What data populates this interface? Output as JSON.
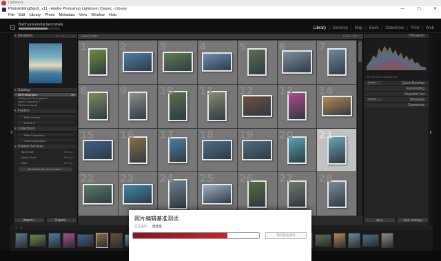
{
  "os_bar": {
    "title": "Lightroom"
  },
  "window": {
    "title": "PhotoEditingBatch_v11 - Adobe Photoshop Lightroom Classic - Library",
    "minimize": "—",
    "maximize": "▢",
    "close": "✕"
  },
  "menu": [
    "File",
    "Edit",
    "Library",
    "Photo",
    "Metadata",
    "View",
    "Window",
    "Help"
  ],
  "identity_plate": {
    "badge": "Lr",
    "task_label": "Batch processing benchmark",
    "task_progress": 0.7,
    "modules": [
      "Library",
      "Develop",
      "Map",
      "Book",
      "Slideshow",
      "Print",
      "Web"
    ],
    "active_module": "Library"
  },
  "left_panel": {
    "navigator": {
      "title": "Navigator",
      "options": "FIT  FILL  1:1  3:1"
    },
    "catalog": {
      "title": "Catalog",
      "items": [
        {
          "label": "All Photographs",
          "count": "44"
        },
        {
          "label": "All Synced Photographs",
          "count": ""
        },
        {
          "label": "Quick Collection +",
          "count": ""
        },
        {
          "label": "Previous Import",
          "count": ""
        }
      ]
    },
    "folders": {
      "title": "Folders",
      "rows": [
        "Filter Folders",
        "DRIVE C"
      ]
    },
    "collections": {
      "title": "Collections",
      "rows": [
        "Filter Collections",
        "Smart Collections"
      ]
    },
    "publish": {
      "title": "Publish Services",
      "services": [
        {
          "label": "Hard Drive",
          "setup": "Set Up..."
        },
        {
          "label": "Adobe Stock",
          "setup": "Set Up..."
        },
        {
          "label": "Flickr",
          "setup": "Set Up..."
        }
      ],
      "find_more": "Find More Services Online..."
    },
    "import_label": "Import...",
    "export_label": "Export..."
  },
  "library_filter": {
    "title": "Library Filter :",
    "options": [
      "Text",
      "Attribute",
      "Metadata",
      "None"
    ],
    "selected": "None",
    "presets": "Filters Off ▾"
  },
  "grid": {
    "selected_index": 21,
    "cells": [
      {
        "n": "1",
        "w": 28,
        "h": 40,
        "c": "#6f8a3e"
      },
      {
        "n": "2",
        "w": 44,
        "h": 30,
        "c": "#4f7ea1"
      },
      {
        "n": "3",
        "w": 44,
        "h": 30,
        "c": "#5d7f52"
      },
      {
        "n": "4",
        "w": 44,
        "h": 28,
        "c": "#6a8fb0"
      },
      {
        "n": "5",
        "w": 28,
        "h": 40,
        "c": "#5d6e54"
      },
      {
        "n": "6",
        "w": 44,
        "h": 34,
        "c": "#7f8fa0"
      },
      {
        "n": "7",
        "w": 28,
        "h": 40,
        "c": "#6d8a9e"
      },
      {
        "n": "8",
        "w": 30,
        "h": 42,
        "c": "#7d8b5e"
      },
      {
        "n": "9",
        "w": 28,
        "h": 42,
        "c": "#8a8f8b"
      },
      {
        "n": "10",
        "w": 28,
        "h": 44,
        "c": "#5a6f4e"
      },
      {
        "n": "11",
        "w": 28,
        "h": 44,
        "c": "#8c8b70"
      },
      {
        "n": "12",
        "w": 44,
        "h": 32,
        "c": "#6b4f3a"
      },
      {
        "n": "13",
        "w": 28,
        "h": 42,
        "c": "#b04a8e"
      },
      {
        "n": "14",
        "w": 44,
        "h": 30,
        "c": "#b78a4f"
      },
      {
        "n": "15",
        "w": 44,
        "h": 30,
        "c": "#3f5f85"
      },
      {
        "n": "16",
        "w": 28,
        "h": 40,
        "c": "#8a6d3f"
      },
      {
        "n": "17",
        "w": 28,
        "h": 38,
        "c": "#4d7fa0"
      },
      {
        "n": "18",
        "w": 44,
        "h": 30,
        "c": "#4d6e86"
      },
      {
        "n": "19",
        "w": 44,
        "h": 30,
        "c": "#4e6f7d"
      },
      {
        "n": "20",
        "w": 28,
        "h": 40,
        "c": "#56a3b0"
      },
      {
        "n": "21",
        "w": 28,
        "h": 42,
        "c": "#6ba3b8"
      },
      {
        "n": "22",
        "w": 44,
        "h": 30,
        "c": "#5b7a64"
      },
      {
        "n": "23",
        "w": 44,
        "h": 30,
        "c": "#3f85a8"
      },
      {
        "n": "24",
        "w": 28,
        "h": 44,
        "c": "#6e7e8c"
      },
      {
        "n": "25",
        "w": 44,
        "h": 30,
        "c": "#9bb0be"
      },
      {
        "n": "26",
        "w": 28,
        "h": 40,
        "c": "#596a3f"
      },
      {
        "n": "27",
        "w": 28,
        "h": 40,
        "c": "#6d7c6a"
      },
      {
        "n": "28",
        "w": 28,
        "h": 40,
        "c": "#7a8c9a"
      }
    ]
  },
  "right_panel": {
    "histogram": {
      "title": "Histogram",
      "info": "ISO 100   24mm   f/8   1/250 sec"
    },
    "quick_develop": {
      "title": "Quick Develop",
      "preset": "Saved Preset"
    },
    "keywording": "Keywording",
    "keyword_list": "Keyword List",
    "metadata": {
      "title": "Metadata",
      "preset": "Default"
    },
    "comments": "Comments",
    "sync_label": "Sync",
    "sync_settings_label": "Sync Settings"
  },
  "filmstrip": {
    "page1": "1",
    "page2": "2",
    "source": "All Photographs",
    "count": "44 photos / 1 selected / original_021.jpg",
    "filter_label": "Filter :",
    "filter_value": "Filters Off",
    "thumb_colors": [
      "#5b7a8e",
      "#6f8a3e",
      "#4f7ea1",
      "#b04a8e",
      "#3f5f85",
      "#8a6d3f",
      "#6b4f3a",
      "#56a3b0",
      "#596a3f",
      "#7a8c9a",
      "#3f85a8",
      "#9bb0be",
      "#4d7fa0",
      "#8c8b70",
      "#6e7e8c",
      "#5d7f52",
      "#4e6f7d",
      "#6a8fb0",
      "#7f8fa0",
      "#5a6f4e",
      "#b78a4f",
      "#6d8a9e",
      "#4d6e86",
      "#8a8f8b"
    ]
  },
  "dialog": {
    "title": "照片编辑基准测试",
    "status_label": "正在运行:",
    "status_value": "批处理",
    "progress": 0.75,
    "button_label": "取消基准测试"
  }
}
